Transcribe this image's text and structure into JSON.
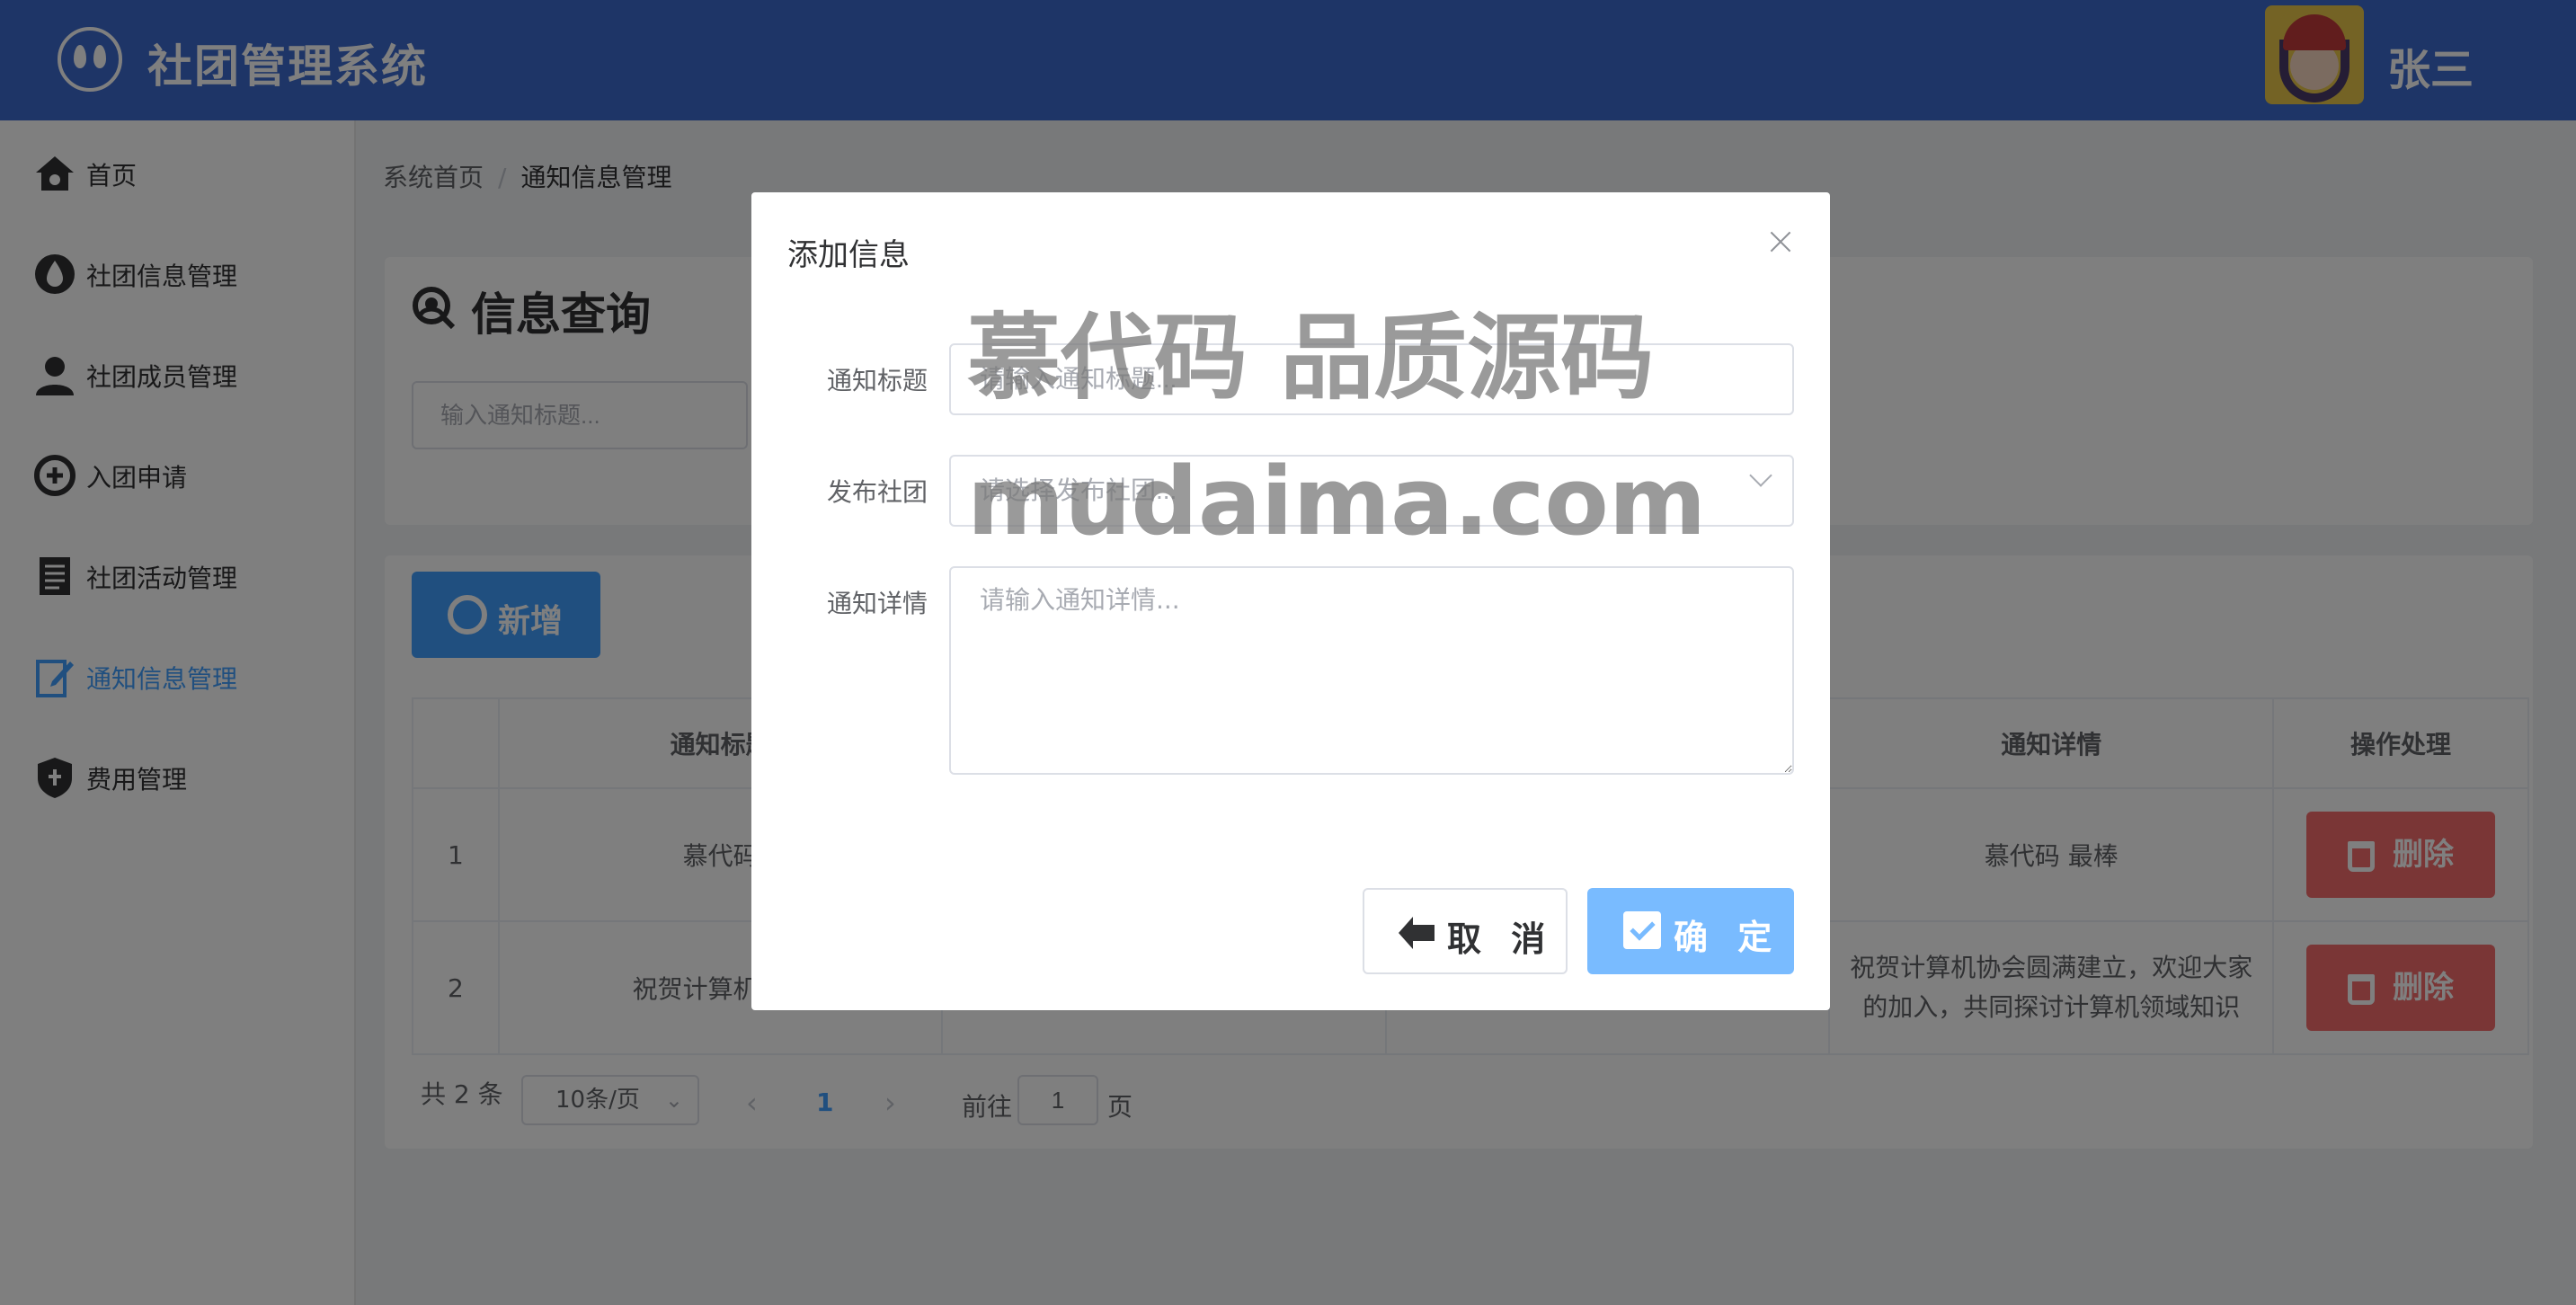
{
  "app": {
    "title": "社团管理系统",
    "username": "张三"
  },
  "sidebar": {
    "items": [
      {
        "label": "首页",
        "icon": "home-icon"
      },
      {
        "label": "社团信息管理",
        "icon": "drop-icon"
      },
      {
        "label": "社团成员管理",
        "icon": "user-icon"
      },
      {
        "label": "入团申请",
        "icon": "add-circle-icon"
      },
      {
        "label": "社团活动管理",
        "icon": "document-icon"
      },
      {
        "label": "通知信息管理",
        "icon": "edit-icon",
        "active": true
      },
      {
        "label": "费用管理",
        "icon": "shield-icon"
      }
    ]
  },
  "breadcrumb": {
    "home": "系统首页",
    "separator": "/",
    "current": "通知信息管理"
  },
  "search": {
    "title": "信息查询",
    "placeholder": "输入通知标题..."
  },
  "toolbar": {
    "add_label": "新增"
  },
  "table": {
    "headers": [
      "",
      "通知标题",
      "",
      "",
      "通知详情",
      "操作处理"
    ],
    "rows": [
      {
        "index": "1",
        "title": "慕代码",
        "detail": "慕代码 最棒",
        "action": "删除"
      },
      {
        "index": "2",
        "title": "祝贺计算机协会",
        "detail": "祝贺计算机协会圆满建立，欢迎大家的加入，共同探讨计算机领域知识",
        "action": "删除"
      }
    ]
  },
  "pagination": {
    "total": "共 2 条",
    "page_size": "10条/页",
    "current": "1",
    "goto_prefix": "前往",
    "goto_value": "1",
    "goto_suffix": "页"
  },
  "dialog": {
    "title": "添加信息",
    "fields": {
      "title_label": "通知标题",
      "title_placeholder": "请输入通知标题...",
      "club_label": "发布社团",
      "club_placeholder": "请选择发布社团...",
      "detail_label": "通知详情",
      "detail_placeholder": "请输入通知详情..."
    },
    "cancel_label": "取 消",
    "confirm_label": "确 定"
  },
  "watermark": {
    "line1": "慕代码 品质源码",
    "line2": "mudaima.com"
  },
  "colors": {
    "header": "#3d6bcf",
    "primary": "#409eff",
    "danger": "#f56c6c"
  }
}
